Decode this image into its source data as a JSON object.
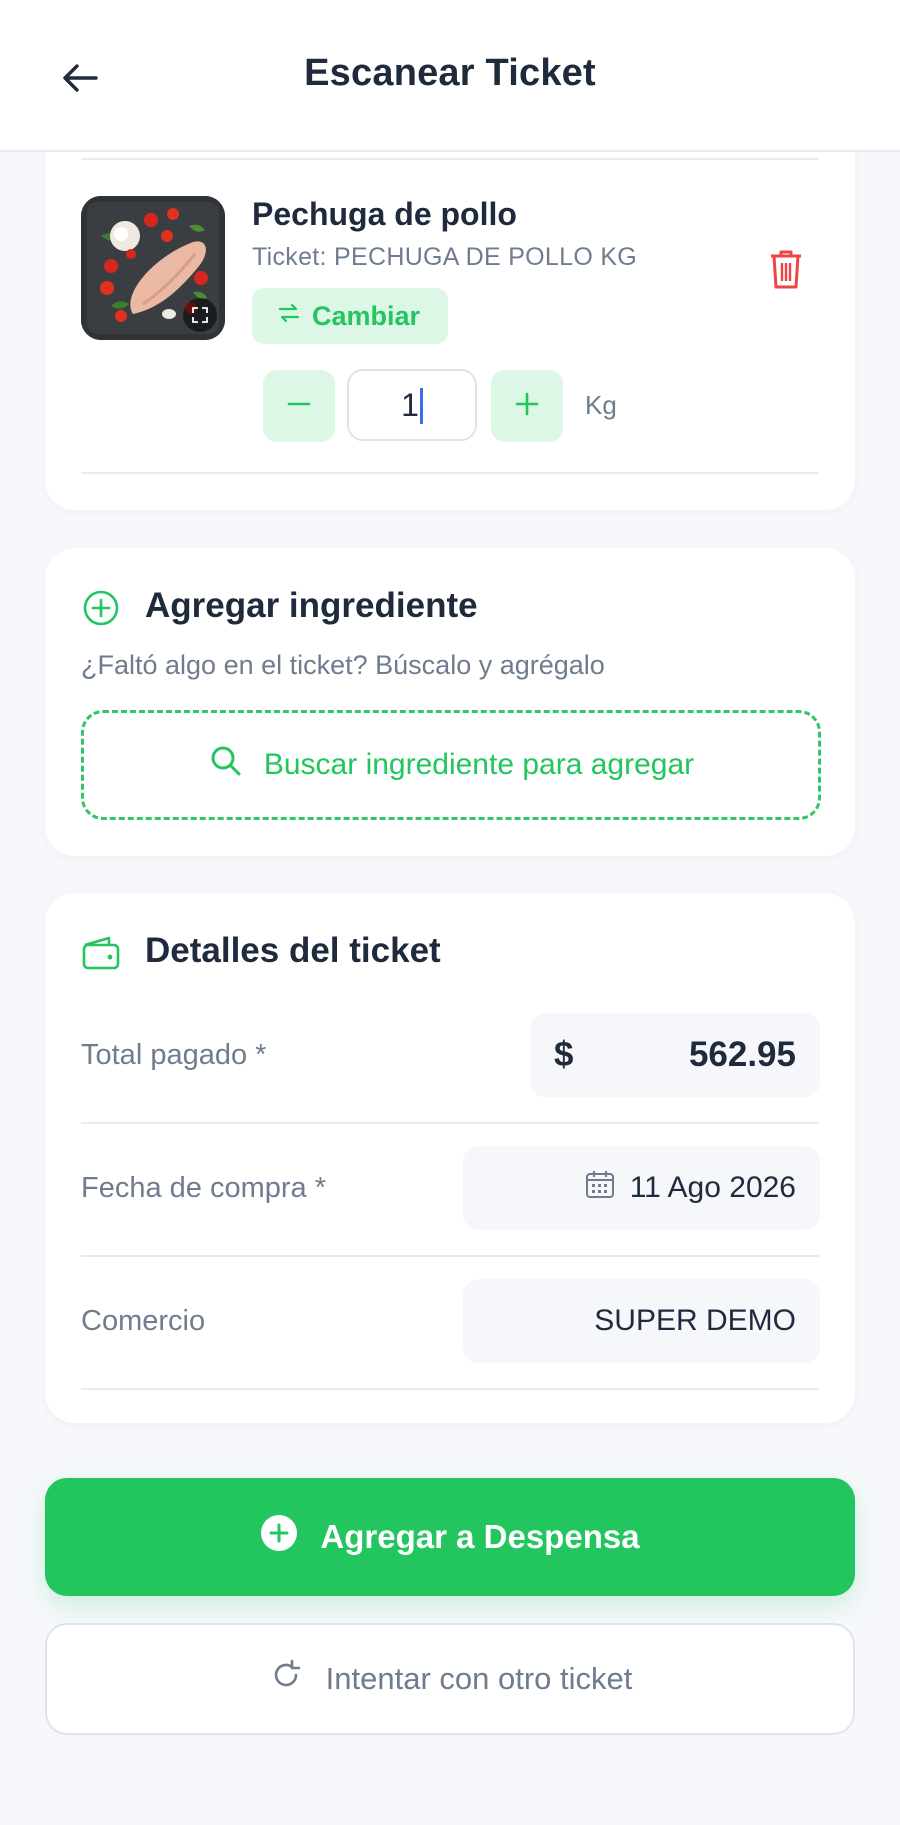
{
  "header": {
    "title": "Escanear Ticket",
    "back_icon": "arrow-left-icon"
  },
  "product": {
    "name": "Pechuga de pollo",
    "ticket_text": "Ticket: PECHUGA DE POLLO KG",
    "change_label": "Cambiar",
    "quantity": "1",
    "unit": "Kg",
    "icons": [
      "swap-icon",
      "trash-icon",
      "minus-icon",
      "plus-icon",
      "expand-icon"
    ]
  },
  "add_ingredient": {
    "title": "Agregar ingrediente",
    "subtitle": "¿Faltó algo en el ticket? Búscalo y agrégalo",
    "search_label": "Buscar ingrediente para agregar"
  },
  "details": {
    "title": "Detalles del ticket",
    "total_label": "Total pagado *",
    "currency": "$",
    "total_value": "562.95",
    "date_label": "Fecha de compra *",
    "date_value": "11 Ago 2026",
    "store_label": "Comercio",
    "store_value": "SUPER DEMO"
  },
  "actions": {
    "primary_label": "Agregar a Despensa",
    "secondary_label": "Intentar con otro ticket"
  },
  "colors": {
    "accent": "#22c55e",
    "accent_light": "#ddf7e6",
    "danger": "#ef4444",
    "text_dark": "#1f2a3d",
    "text_muted": "#6f7c8f",
    "background": "#f6f8fb"
  }
}
